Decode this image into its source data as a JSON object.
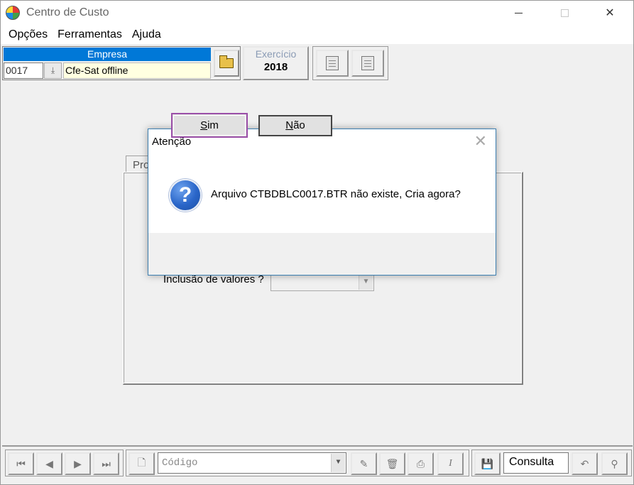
{
  "window": {
    "title": "Centro de Custo"
  },
  "menu": {
    "items": [
      "Opções",
      "Ferramentas",
      "Ajuda"
    ]
  },
  "empresa": {
    "label": "Empresa",
    "code": "0017",
    "name": "Cfe-Sat offline"
  },
  "exercicio": {
    "label": "Exercício",
    "value": "2018"
  },
  "form": {
    "tab_label": "Pro",
    "inclusao_label": "Inclusão de valores ?"
  },
  "dialog": {
    "title": "Atenção",
    "message": "Arquivo CTBDBLC0017.BTR não existe, Cria agora?",
    "sim_rest": "im",
    "sim_key": "S",
    "nao_key": "N",
    "nao_rest": "ão"
  },
  "navbar": {
    "codigo_placeholder": "Código",
    "mode": "Consulta"
  }
}
